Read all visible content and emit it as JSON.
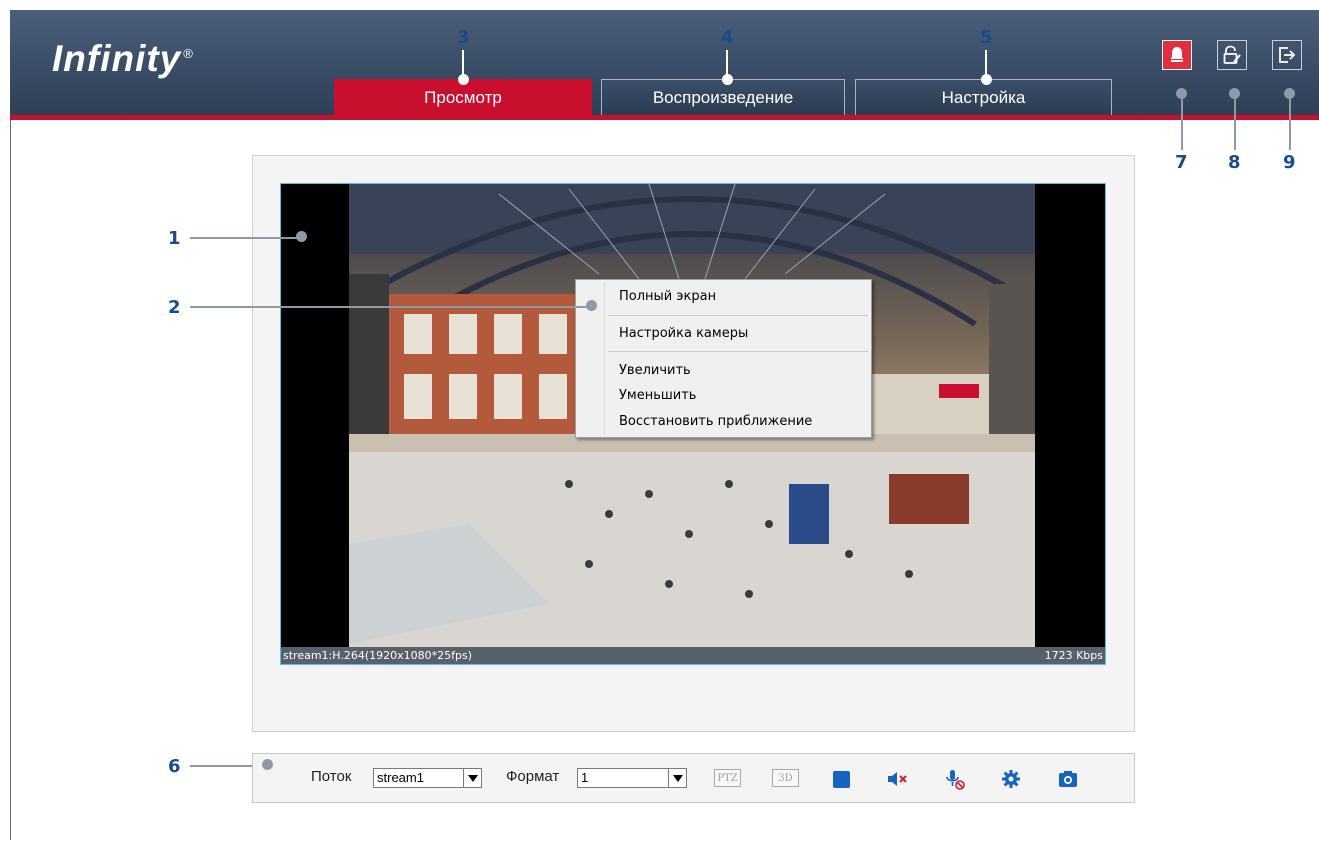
{
  "header": {
    "logo": "Infinity",
    "logo_mark": "®",
    "tabs": [
      {
        "label": "Просмотр",
        "active": true
      },
      {
        "label": "Воспроизведение",
        "active": false
      },
      {
        "label": "Настройка",
        "active": false
      }
    ],
    "buttons": [
      {
        "icon": "alarm-bell-icon"
      },
      {
        "icon": "unlock-edit-icon"
      },
      {
        "icon": "logout-icon"
      }
    ]
  },
  "callouts": [
    "1",
    "2",
    "3",
    "4",
    "5",
    "6",
    "7",
    "8",
    "9"
  ],
  "video": {
    "stream_info": "stream1:H.264(1920x1080*25fps)",
    "bitrate": "1723 Kbps"
  },
  "context_menu": {
    "items": [
      "Полный экран",
      "Настройка камеры",
      "Увеличить",
      "Уменьшить",
      "Восстановить приближение"
    ]
  },
  "toolbar": {
    "stream_label": "Поток",
    "stream_value": "stream1",
    "format_label": "Формат",
    "format_value": "1",
    "ptz_label": "PTZ",
    "threed_label": "3D",
    "icons": [
      "stop-icon",
      "mute-icon",
      "mic-off-icon",
      "settings-icon",
      "snapshot-icon"
    ]
  },
  "colors": {
    "header": "#34465e",
    "accent_red": "#c8102e",
    "callout_blue": "#1a4b8c",
    "toolbar_icon_blue": "#1565c0"
  }
}
